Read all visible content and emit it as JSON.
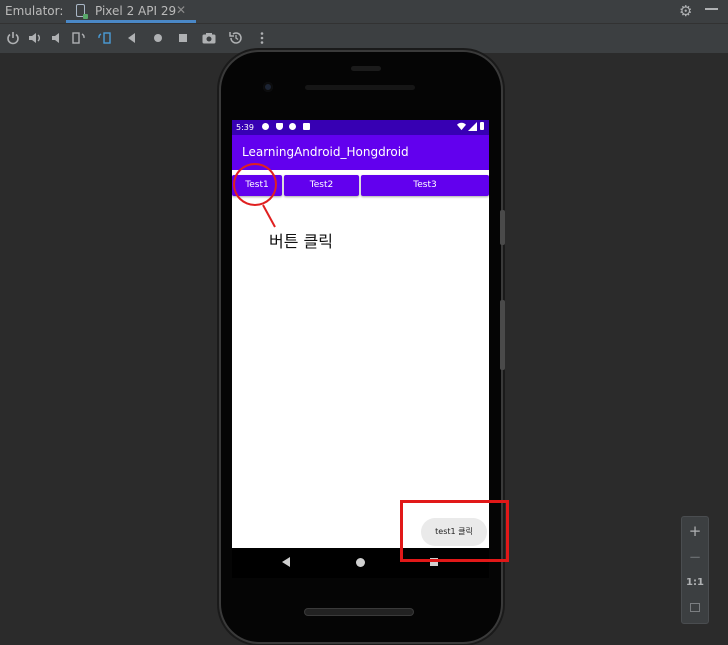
{
  "topbar": {
    "emulator_label": "Emulator:",
    "tab_label": "Pixel 2 API 29",
    "tab_close": "✕"
  },
  "toolbar": {
    "icons": [
      "power-icon",
      "volume-up-icon",
      "volume-down-icon",
      "rotate-left-icon",
      "rotate-right-icon",
      "back-icon",
      "home-icon",
      "overview-icon",
      "screenshot-icon",
      "snapshot-icon",
      "more-icon"
    ]
  },
  "device": {
    "status_time": "5:39",
    "app_title": "LearningAndroid_Hongdroid",
    "buttons": [
      "Test1",
      "Test2",
      "Test3"
    ],
    "toast": "test1 클릭"
  },
  "annotation": {
    "label": "버튼 클릭",
    "color": "#e02020"
  },
  "zoom": {
    "plus": "+",
    "minus": "−",
    "one_to_one": "1:1"
  },
  "colors": {
    "primary": "#6200ee",
    "primary_dark": "#3700b3",
    "ide_bg": "#2b2b2b",
    "tab_accent": "#4a88c7"
  }
}
